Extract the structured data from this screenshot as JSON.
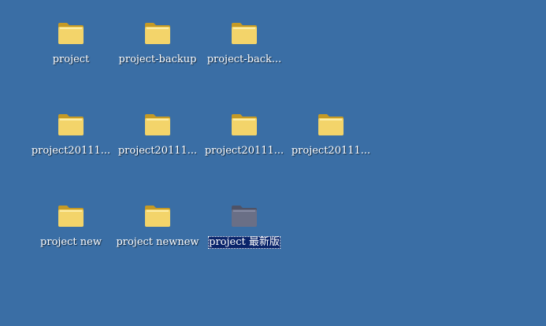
{
  "colors": {
    "desktop_background": "#3a6ea5",
    "folder_body": "#f3d46a",
    "folder_edge": "#c59a25",
    "folder_selected_tint": "#6a6f86",
    "selection_background": "#0a246a"
  },
  "desktop": {
    "icons": [
      {
        "label": "project",
        "icon": "folder-icon",
        "selected": false
      },
      {
        "label": "project-backup",
        "icon": "folder-icon",
        "selected": false
      },
      {
        "label": "project-back...",
        "icon": "folder-icon",
        "selected": false
      },
      {
        "label": "project20111...",
        "icon": "folder-icon",
        "selected": false
      },
      {
        "label": "project20111...",
        "icon": "folder-icon",
        "selected": false
      },
      {
        "label": "project20111...",
        "icon": "folder-icon",
        "selected": false
      },
      {
        "label": "project20111...",
        "icon": "folder-icon",
        "selected": false
      },
      {
        "label": "project new",
        "icon": "folder-icon",
        "selected": false
      },
      {
        "label": "project newnew",
        "icon": "folder-icon",
        "selected": false
      },
      {
        "label": "project 最新版",
        "icon": "folder-icon",
        "selected": true
      }
    ]
  }
}
